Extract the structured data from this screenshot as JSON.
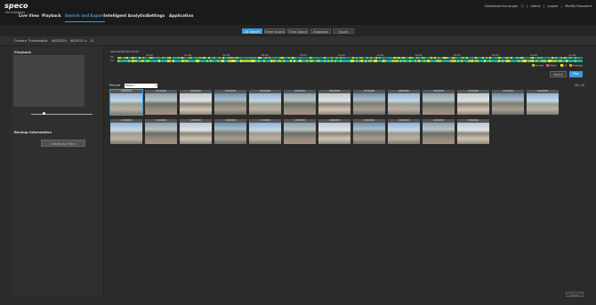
{
  "brand": {
    "logo": "speco",
    "subtitle": "technologies"
  },
  "top_links": {
    "plugin": "Download the plugin",
    "user": "admin",
    "logout": "Logout",
    "modify_password": "Modify Password"
  },
  "nav": [
    {
      "label": "Live View"
    },
    {
      "label": "Playback"
    },
    {
      "label": "Search and Export"
    },
    {
      "label": "Intelligent Analytics"
    },
    {
      "label": "Settings"
    },
    {
      "label": "Application"
    }
  ],
  "subtabs": [
    {
      "label": "All Search"
    },
    {
      "label": "Event Search"
    },
    {
      "label": "Time Search"
    },
    {
      "label": "Snapshots"
    },
    {
      "label": "Export Status"
    }
  ],
  "breadcrumb": {
    "parts": [
      "Camera Thumbnails",
      ">",
      "08/2022",
      ">",
      "06/2022",
      ">",
      "11"
    ]
  },
  "left_panel": {
    "playback_title": "Playback",
    "backup_title": "Backup Information",
    "backup_button": "Set Backup Time"
  },
  "timeline": {
    "date": "06/19/2022 00:00:00",
    "ticks": [
      "02:00",
      "04:00",
      "06:00",
      "08:00",
      "10:00",
      "12:00",
      "14:00",
      "16:00",
      "18:00",
      "20:00",
      "22:00",
      "24:00"
    ],
    "row_labels": [
      "Rec",
      "Evt"
    ],
    "legend": [
      "Normal",
      "Motion",
      "I/O",
      "Analytics"
    ],
    "search_button": "Search",
    "play_button": "Play"
  },
  "pictures": {
    "label": "Picture",
    "select_value": "Motion",
    "count": "28 / 28"
  },
  "thumbs": [
    "00:00:00",
    "01:00:00",
    "02:00:00",
    "03:00:00",
    "04:00:00",
    "05:00:00",
    "06:00:00",
    "07:00:00",
    "08:00:00",
    "09:00:00",
    "10:00:00",
    "11:00:00",
    "12:00:00",
    "13:00:00",
    "14:00:00",
    "15:00:00",
    "16:00:00",
    "17:00:00",
    "18:00:00",
    "19:00:00",
    "20:00:00",
    "21:00:00",
    "22:00:00",
    "23:00:00"
  ],
  "footer": {
    "button": "Export"
  },
  "colors": {
    "accent": "#3a9ad9",
    "bg": "#2b2b2b",
    "topbar": "#1a1a1a",
    "timeline_green": "#8dc63f",
    "timeline_yellow": "#e6e03a",
    "timeline_teal": "#1ea89a"
  },
  "icons": [
    "help-icon"
  ]
}
